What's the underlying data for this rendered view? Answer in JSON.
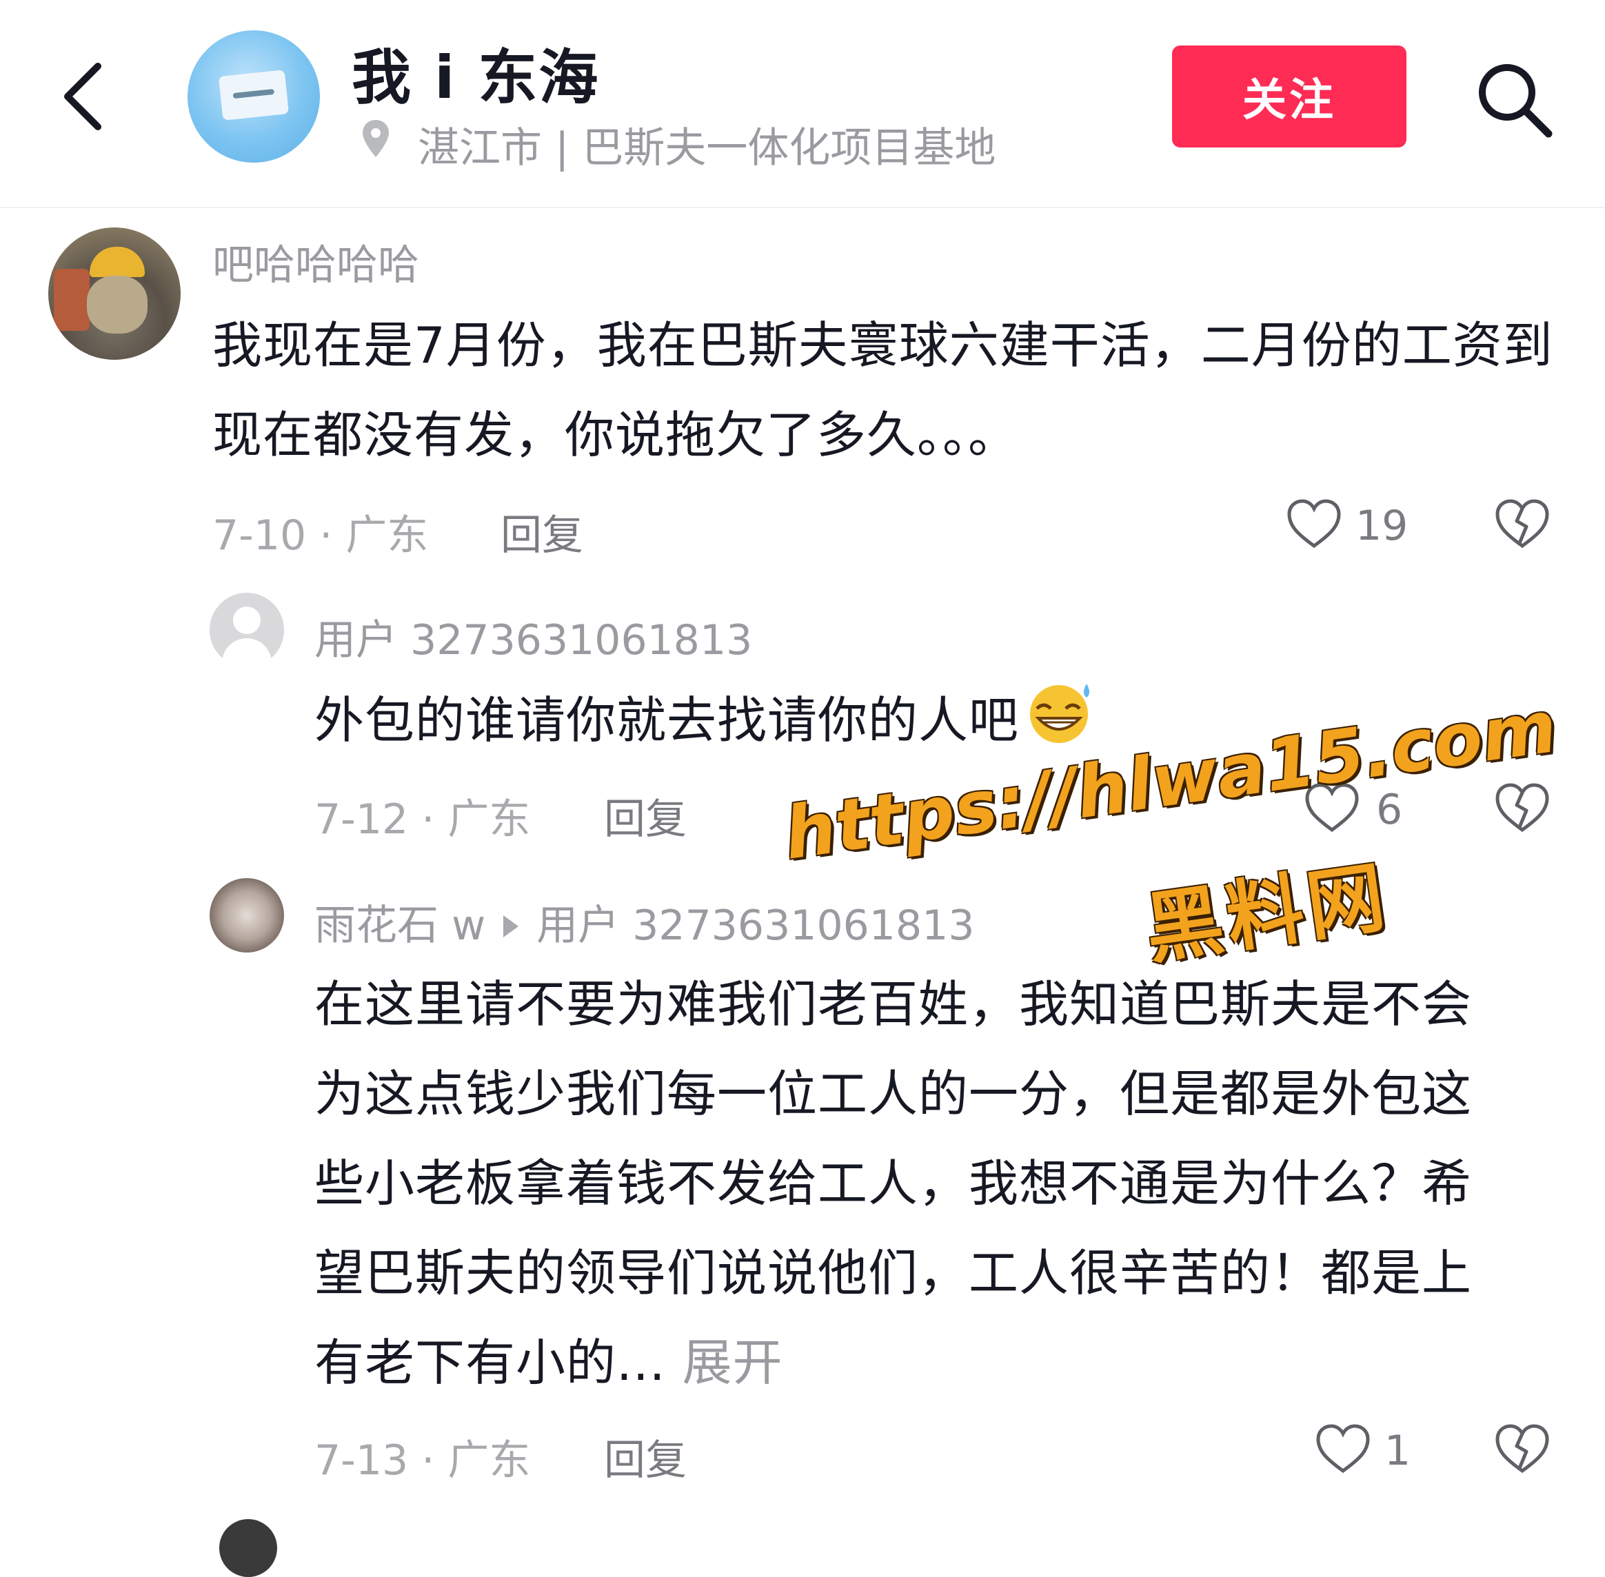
{
  "header": {
    "account_name": "我 i 东海",
    "location": "湛江市 | 巴斯夫一体化项目基地",
    "follow_label": "关注"
  },
  "comments": [
    {
      "username": "吧哈哈哈哈",
      "text": "我现在是7月份，我在巴斯夫寰球六建干活，二月份的工资到现在都没有发，你说拖欠了多久。。。",
      "date_location": "7-10 · 广东",
      "reply_label": "回复",
      "likes": "19"
    },
    {
      "username": "用户 3273631061813",
      "text": "外包的谁请你就去找请你的人吧",
      "emoji": "sweat-grin-emoji",
      "date_location": "7-12 · 广东",
      "reply_label": "回复",
      "likes": "6"
    },
    {
      "username": "雨花石 w",
      "reply_to": "用户 3273631061813",
      "text": "在这里请不要为难我们老百姓，我知道巴斯夫是不会为这点钱少我们每一位工人的一分，但是都是外包这些小老板拿着钱不发给工人，我想不通是为什么？希望巴斯夫的领导们说说他们，工人很辛苦的！都是上有老下有小的...",
      "expand_label": "展开",
      "date_location": "7-13 · 广东",
      "reply_label": "回复",
      "likes": "1"
    }
  ],
  "watermark": {
    "url": "https://hlwa15.com",
    "name": "黑料网"
  },
  "colors": {
    "accent": "#fe2c55",
    "secondary_text": "#9a9ba0",
    "watermark": "#f3a21d"
  }
}
